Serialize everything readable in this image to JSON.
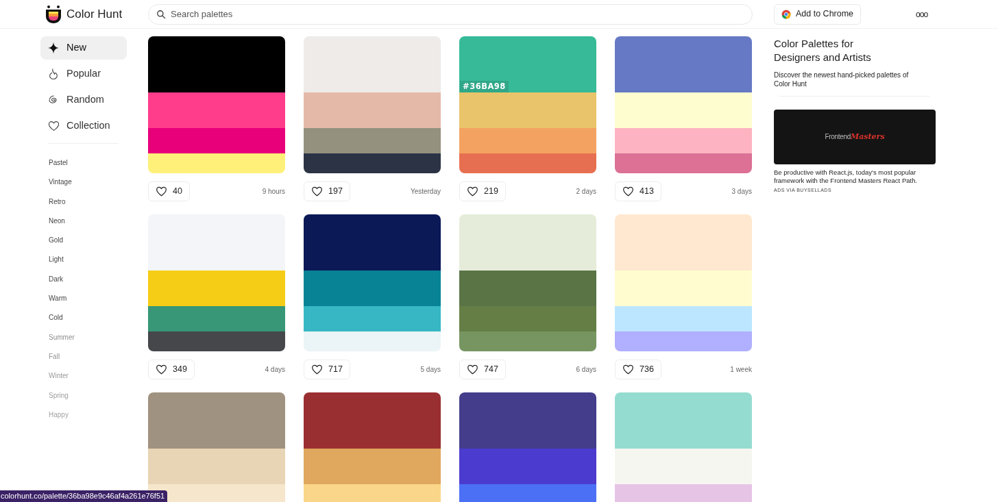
{
  "header": {
    "logo_text": "Color Hunt",
    "search": {
      "placeholder": "Search palettes"
    },
    "chrome_button": "Add to Chrome",
    "more_menu": "ooo"
  },
  "sidebar": {
    "items": [
      {
        "label": "New",
        "kind": "sparkle",
        "selected": true
      },
      {
        "label": "Popular",
        "kind": "flame",
        "selected": false
      },
      {
        "label": "Random",
        "kind": "spiral",
        "selected": false
      },
      {
        "label": "Collection",
        "kind": "heart",
        "selected": false
      }
    ],
    "tags": [
      "Pastel",
      "Vintage",
      "Retro",
      "Neon",
      "Gold",
      "Light",
      "Dark",
      "Warm",
      "Cold",
      "Summer",
      "Fall",
      "Winter",
      "Spring",
      "Happy"
    ]
  },
  "palettes": [
    {
      "stripes": [
        {
          "color": "#000000"
        },
        {
          "color": "#ff3d8b"
        },
        {
          "color": "#e8007a"
        },
        {
          "color": "#fff07a"
        }
      ],
      "likes": "40",
      "time": "9 hours"
    },
    {
      "stripes": [
        {
          "color": "#eeebe9"
        },
        {
          "color": "#e5b9a8"
        },
        {
          "color": "#94917f"
        },
        {
          "color": "#2c3345"
        }
      ],
      "likes": "197",
      "time": "Yesterday"
    },
    {
      "stripes": [
        {
          "color": "#36ba98"
        },
        {
          "color": "#e9c46a"
        },
        {
          "color": "#f4a261"
        },
        {
          "color": "#e76f51"
        }
      ],
      "likes": "219",
      "time": "2 days",
      "hex_label": "#36BA98"
    },
    {
      "stripes": [
        {
          "color": "#6679c4"
        },
        {
          "color": "#fdfdd0"
        },
        {
          "color": "#fdb3c1"
        },
        {
          "color": "#dc7095"
        }
      ],
      "likes": "413",
      "time": "3 days"
    },
    {
      "stripes": [
        {
          "color": "#f3f5f8"
        },
        {
          "color": "#f5cd16"
        },
        {
          "color": "#379777"
        },
        {
          "color": "#45474b"
        }
      ],
      "likes": "349",
      "time": "4 days"
    },
    {
      "stripes": [
        {
          "color": "#0b1957"
        },
        {
          "color": "#088395"
        },
        {
          "color": "#37b7c3"
        },
        {
          "color": "#ebf4f6"
        }
      ],
      "likes": "717",
      "time": "5 days"
    },
    {
      "stripes": [
        {
          "color": "#e5ecda"
        },
        {
          "color": "#5a7446"
        },
        {
          "color": "#657e45"
        },
        {
          "color": "#769561"
        }
      ],
      "likes": "747",
      "time": "6 days"
    },
    {
      "stripes": [
        {
          "color": "#ffe8cf"
        },
        {
          "color": "#fffdd0"
        },
        {
          "color": "#bce6ff"
        },
        {
          "color": "#b1afff"
        }
      ],
      "likes": "736",
      "time": "1 week"
    },
    {
      "stripes": [
        {
          "color": "#a09280"
        },
        {
          "color": "#e8d5b5"
        },
        {
          "color": "#f6e6cb"
        }
      ]
    },
    {
      "stripes": [
        {
          "color": "#9a2f31"
        },
        {
          "color": "#e0a75e"
        },
        {
          "color": "#f9d689"
        }
      ]
    },
    {
      "stripes": [
        {
          "color": "#433d8b"
        },
        {
          "color": "#4c3bcf"
        },
        {
          "color": "#4b70f5"
        }
      ]
    },
    {
      "stripes": [
        {
          "color": "#95dcd0"
        },
        {
          "color": "#f6f6f1"
        },
        {
          "color": "#e6c4e6"
        }
      ]
    }
  ],
  "aside": {
    "title": "Color Palettes for Designers and Artists",
    "subtitle": "Discover the newest hand-picked palettes of Color Hunt",
    "ad": {
      "brand_first": "Frontend",
      "brand_second": "Masters",
      "text": "Be productive with React.js, today's most popular framework with the Frontend Masters React Path.",
      "credit": "ADS VIA BUYSELLADS"
    }
  },
  "status_url": "colorhunt.co/palette/36ba98e9c46af4a261e76f51"
}
